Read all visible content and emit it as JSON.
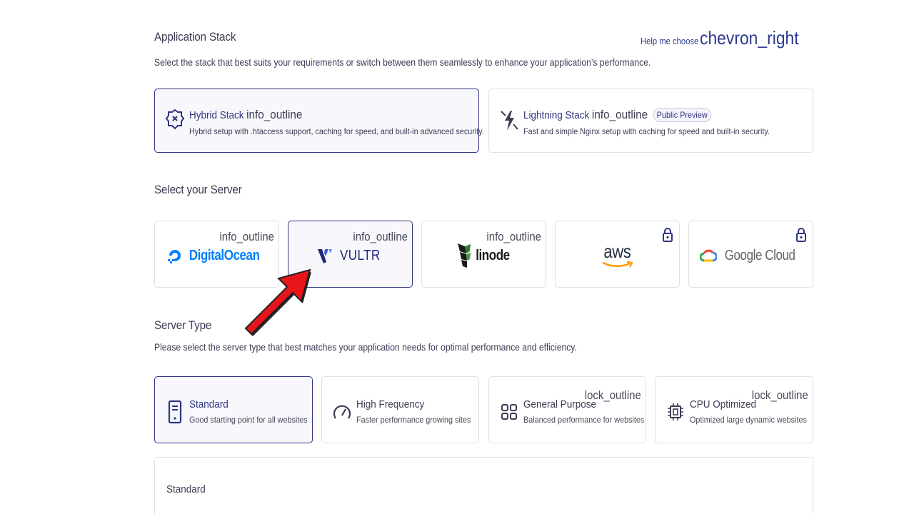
{
  "stack": {
    "title": "Application Stack",
    "description": "Select the stack that best suits your requirements or switch between them seamlessly to enhance your application’s performance.",
    "help_label": "Help me choose",
    "help_icon": "chevron_right",
    "options": [
      {
        "name": "Hybrid Stack",
        "info": "info_outline",
        "description": "Hybrid setup with .htaccess support, caching for speed, and built-in advanced security.",
        "selected": true,
        "icon": "hybrid-stack-icon"
      },
      {
        "name": "Lightning Stack",
        "info": "info_outline",
        "badge": "Public Preview",
        "description": "Fast and simple Nginx setup with caching for speed and built-in security.",
        "selected": false,
        "icon": "lightning-icon"
      }
    ]
  },
  "server": {
    "title": "Select your Server",
    "providers": [
      {
        "name": "DigitalOcean",
        "info": "info_outline",
        "locked": false,
        "selected": false,
        "color": "#0080ff"
      },
      {
        "name": "VULTR",
        "info": "info_outline",
        "locked": false,
        "selected": true,
        "color": "#1e2a78"
      },
      {
        "name": "linode",
        "info": "info_outline",
        "locked": false,
        "selected": false,
        "color": "#1a1a1a"
      },
      {
        "name": "aws",
        "locked": true,
        "selected": false,
        "color": "#232f3e"
      },
      {
        "name": "Google Cloud",
        "locked": true,
        "selected": false,
        "color": "#5f6368"
      }
    ]
  },
  "server_type": {
    "title": "Server Type",
    "description": "Please select the server type that best matches your application needs for optimal performance and efficiency.",
    "options": [
      {
        "name": "Standard",
        "description": "Good starting point for all websites",
        "selected": true,
        "locked": false,
        "icon": "server-icon"
      },
      {
        "name": "High Frequency",
        "description": "Faster performance growing sites",
        "selected": false,
        "locked": false,
        "icon": "speedometer-icon"
      },
      {
        "name": "General Purpose",
        "description": "Balanced performance for websites",
        "selected": false,
        "locked": true,
        "lock_label": "lock_outline",
        "icon": "grid-icon"
      },
      {
        "name": "CPU Optimized",
        "description": "Optimized large dynamic websites",
        "selected": false,
        "locked": true,
        "lock_label": "lock_outline",
        "icon": "cpu-icon"
      }
    ]
  },
  "plan": {
    "label": "Standard"
  },
  "colors": {
    "accent": "#2f3680",
    "border": "#dfdfe8",
    "arrow": "#e8161b"
  }
}
